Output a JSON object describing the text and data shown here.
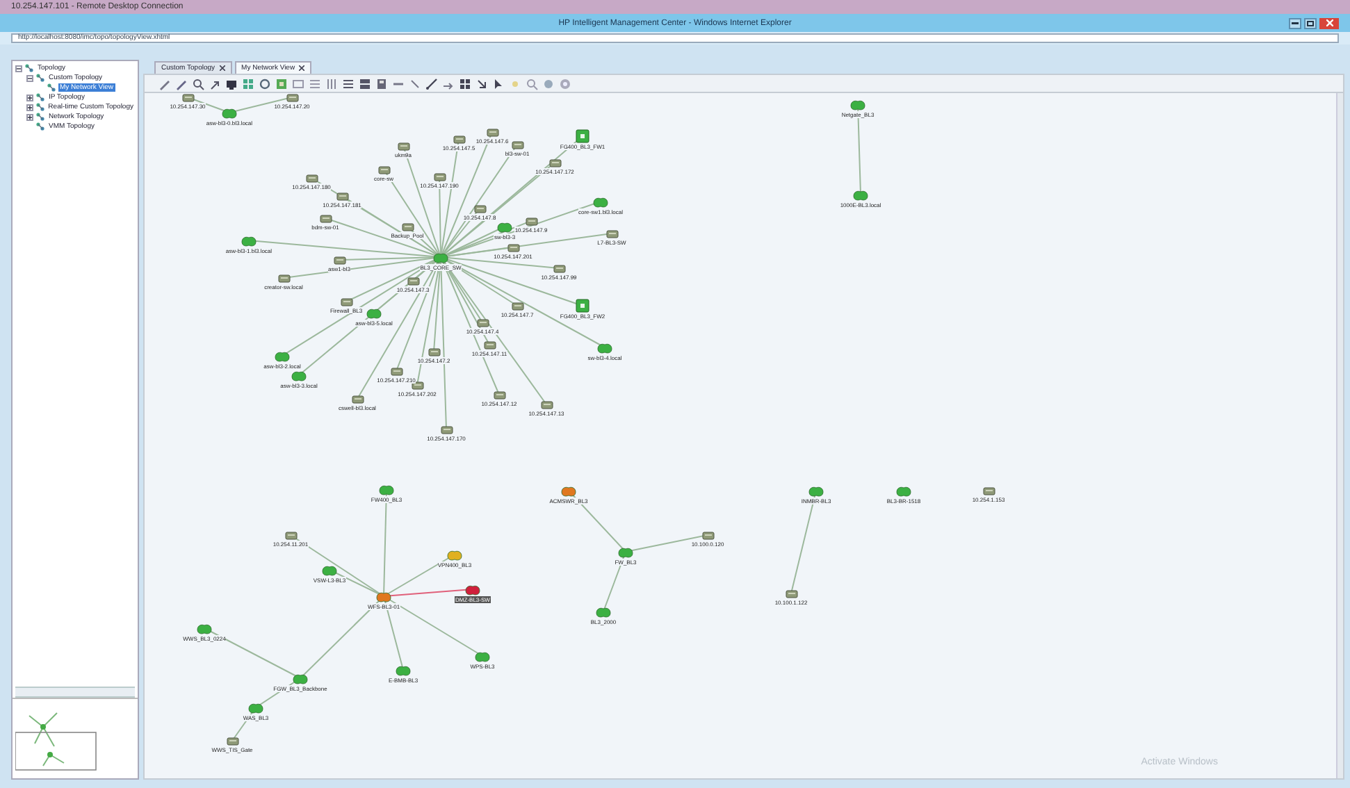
{
  "remote_desktop": {
    "title": "10.254.147.101 - Remote Desktop Connection"
  },
  "window": {
    "title": "HP Intelligent Management Center - Windows Internet Explorer"
  },
  "address_bar": {
    "value": "http://localhost:8080/imc/topo/topologyView.xhtml"
  },
  "tree": [
    {
      "label": "Topology",
      "expanded": true,
      "selected": false,
      "children": [
        {
          "label": "Custom Topology",
          "expanded": true,
          "selected": false,
          "children": [
            {
              "label": "My Network View",
              "selected": true
            }
          ]
        },
        {
          "label": "IP Topology",
          "expanded": false,
          "selected": false
        },
        {
          "label": "Real-time Custom Topology",
          "expanded": false,
          "selected": false
        },
        {
          "label": "Network Topology",
          "expanded": false,
          "selected": false
        },
        {
          "label": "VMM Topology",
          "selected": false
        }
      ]
    }
  ],
  "tabs": [
    {
      "label": "Custom Topology",
      "selected": false
    },
    {
      "label": "My Network View",
      "selected": true
    }
  ],
  "topology": {
    "nodes": [
      {
        "label": "BL3_CORE_SW",
        "kind": "router",
        "color": "#3cb043"
      },
      {
        "label": "ukm9a",
        "kind": "device",
        "color": "#8f9a78"
      },
      {
        "label": "10.254.147.5",
        "kind": "device",
        "color": "#8f9a78"
      },
      {
        "label": "10.254.147.6",
        "kind": "device",
        "color": "#8f9a78"
      },
      {
        "label": "bl3-sw-01",
        "kind": "device",
        "color": "#8f9a78"
      },
      {
        "label": "FG400_BL3_FW1",
        "kind": "square",
        "color": "#3cb043"
      },
      {
        "label": "10.254.147.172",
        "kind": "device",
        "color": "#8f9a78"
      },
      {
        "label": "core-sw",
        "kind": "device",
        "color": "#8f9a78"
      },
      {
        "label": "10.254.147.190",
        "kind": "device",
        "color": "#8f9a78"
      },
      {
        "label": "10.254.147.180",
        "kind": "device",
        "color": "#8f9a78"
      },
      {
        "label": "10.254.147.181",
        "kind": "device",
        "color": "#8f9a78"
      },
      {
        "label": "bdm-sw-01",
        "kind": "device",
        "color": "#8f9a78"
      },
      {
        "label": "Backup_Pool",
        "kind": "device",
        "color": "#8f9a78"
      },
      {
        "label": "10.254.147.8",
        "kind": "device",
        "color": "#8f9a78"
      },
      {
        "label": "sw-bl3-3",
        "kind": "router",
        "color": "#3cb043"
      },
      {
        "label": "10.254.147.9",
        "kind": "device",
        "color": "#8f9a78"
      },
      {
        "label": "core-sw1.bl3.local",
        "kind": "router",
        "color": "#3cb043"
      },
      {
        "label": "L7-BL3-SW",
        "kind": "device",
        "color": "#8f9a78"
      },
      {
        "label": "10.254.147.201",
        "kind": "device",
        "color": "#8f9a78"
      },
      {
        "label": "10.254.147.99",
        "kind": "device",
        "color": "#8f9a78"
      },
      {
        "label": "asw-bl3-1.bl3.local",
        "kind": "router",
        "color": "#3cb043"
      },
      {
        "label": "asw1-bl3",
        "kind": "device",
        "color": "#8f9a78"
      },
      {
        "label": "creator-sw.local",
        "kind": "device",
        "color": "#8f9a78"
      },
      {
        "label": "10.254.147.3",
        "kind": "device",
        "color": "#8f9a78"
      },
      {
        "label": "Firewall_BL3",
        "kind": "device",
        "color": "#8f9a78"
      },
      {
        "label": "asw-bl3-5.local",
        "kind": "router",
        "color": "#3cb043"
      },
      {
        "label": "10.254.147.7",
        "kind": "device",
        "color": "#8f9a78"
      },
      {
        "label": "FG400_BL3_FW2",
        "kind": "square",
        "color": "#3cb043"
      },
      {
        "label": "10.254.147.4",
        "kind": "device",
        "color": "#8f9a78"
      },
      {
        "label": "sw-bl3-4.local",
        "kind": "router",
        "color": "#3cb043"
      },
      {
        "label": "asw-bl3-2.local",
        "kind": "router",
        "color": "#3cb043"
      },
      {
        "label": "asw-bl3-3.local",
        "kind": "router",
        "color": "#3cb043"
      },
      {
        "label": "10.254.147.2",
        "kind": "device",
        "color": "#8f9a78"
      },
      {
        "label": "10.254.147.210",
        "kind": "device",
        "color": "#8f9a78"
      },
      {
        "label": "10.254.147.202",
        "kind": "device",
        "color": "#8f9a78"
      },
      {
        "label": "10.254.147.11",
        "kind": "device",
        "color": "#8f9a78"
      },
      {
        "label": "cswell-bl3.local",
        "kind": "device",
        "color": "#8f9a78"
      },
      {
        "label": "10.254.147.12",
        "kind": "device",
        "color": "#8f9a78"
      },
      {
        "label": "10.254.147.13",
        "kind": "device",
        "color": "#8f9a78"
      },
      {
        "label": "10.254.147.170",
        "kind": "device",
        "color": "#8f9a78"
      },
      {
        "label": "10.254.147.30",
        "kind": "device",
        "color": "#8f9a78"
      },
      {
        "label": "asw-bl3-0.bl3.local",
        "kind": "router",
        "color": "#3cb043"
      },
      {
        "label": "10.254.147.20",
        "kind": "device",
        "color": "#8f9a78"
      },
      {
        "label": "Netgate_BL3",
        "kind": "router",
        "color": "#3cb043"
      },
      {
        "label": "1000E-BL3.local",
        "kind": "router",
        "color": "#3cb043"
      },
      {
        "label": "FW400_BL3",
        "kind": "router",
        "color": "#3cb043"
      },
      {
        "label": "10.254.11.201",
        "kind": "device",
        "color": "#8f9a78"
      },
      {
        "label": "VSW-L3-BL3",
        "kind": "router",
        "color": "#3cb043"
      },
      {
        "label": "WFS-BL3-01",
        "kind": "router",
        "color": "#e07820"
      },
      {
        "label": "VPN400_BL3",
        "kind": "router",
        "color": "#e0b020"
      },
      {
        "label": "DMZ-BL3-SW",
        "kind": "router",
        "color": "#d0203c"
      },
      {
        "label": "E-BMB-BL3",
        "kind": "router",
        "color": "#3cb043"
      },
      {
        "label": "WPS-BL3",
        "kind": "router",
        "color": "#3cb043"
      },
      {
        "label": "FGW_BL3_Backbone",
        "kind": "router",
        "color": "#3cb043"
      },
      {
        "label": "WWS_BL3_0224",
        "kind": "router",
        "color": "#3cb043"
      },
      {
        "label": "WAS_BL3",
        "kind": "router",
        "color": "#3cb043"
      },
      {
        "label": "WWS_TIS_Gate",
        "kind": "device",
        "color": "#8f9a78"
      },
      {
        "label": "ACMSWR_BL3",
        "kind": "router",
        "color": "#e07820"
      },
      {
        "label": "FW_BL3",
        "kind": "router",
        "color": "#3cb043"
      },
      {
        "label": "10.100.0.120",
        "kind": "device",
        "color": "#8f9a78"
      },
      {
        "label": "BL3_2000",
        "kind": "router",
        "color": "#3cb043"
      },
      {
        "label": "INMBR-BL3",
        "kind": "router",
        "color": "#3cb043"
      },
      {
        "label": "10.100.1.122",
        "kind": "device",
        "color": "#8f9a78"
      },
      {
        "label": "BL3-BR-1518",
        "kind": "router",
        "color": "#3cb043"
      },
      {
        "label": "10.254.1.153",
        "kind": "device",
        "color": "#8f9a78"
      }
    ]
  },
  "overlay": {
    "text": "Activate Windows"
  }
}
